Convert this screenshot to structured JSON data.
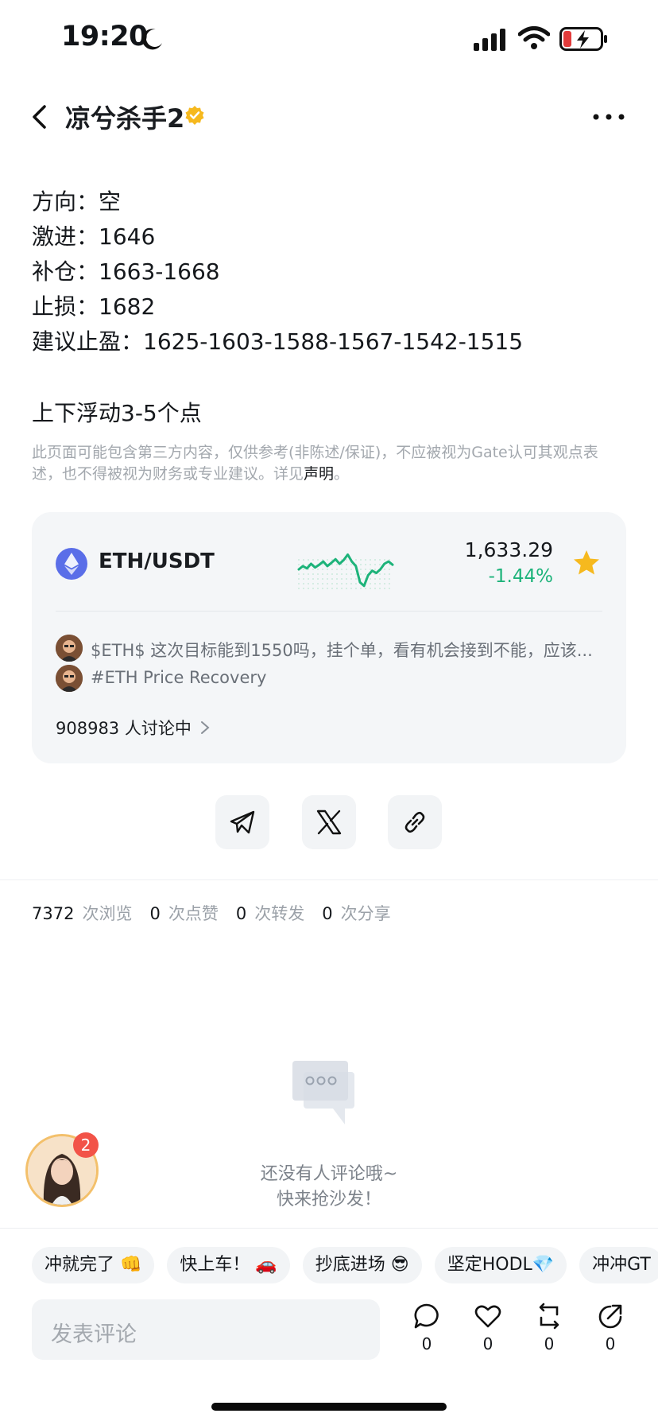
{
  "status_bar": {
    "time": "19:20"
  },
  "header": {
    "title": "凉兮杀手2"
  },
  "post": {
    "lines": [
      "方向：空",
      "激进：1646",
      "补仓：1663-1668",
      "止损：1682",
      "建议止盈：1625-1603-1588-1567-1542-1515"
    ],
    "note": "上下浮动3-5个点",
    "disclaimer": "此页面可能包含第三方内容，仅供参考(非陈述/保证)，不应被视为Gate认可其观点表述，也不得被视为财务或专业建议。详见",
    "disclaimer_link": "声明",
    "disclaimer_end": "。"
  },
  "ticker": {
    "pair": "ETH/USDT",
    "price": "1,633.29",
    "change": "-1.44%",
    "change_color": "#1db37a",
    "sparkline": [
      0.62,
      0.55,
      0.6,
      0.5,
      0.58,
      0.52,
      0.45,
      0.55,
      0.48,
      0.4,
      0.5,
      0.42,
      0.3,
      0.45,
      0.55,
      0.9,
      0.98,
      0.75,
      0.65,
      0.7,
      0.62,
      0.5,
      0.45,
      0.52
    ],
    "discussions": [
      {
        "text": "$ETH$  这次目标能到1550吗，挂个单，看有机会接到不能，应该..."
      },
      {
        "text": "#ETH Price Recovery"
      }
    ],
    "discuss_count": "908983 人讨论中"
  },
  "share": {
    "buttons": [
      "telegram-icon",
      "x-icon",
      "link-icon"
    ]
  },
  "stats": [
    {
      "num": "7372",
      "label": "次浏览"
    },
    {
      "num": "0",
      "label": "次点赞"
    },
    {
      "num": "0",
      "label": "次转发"
    },
    {
      "num": "0",
      "label": "次分享"
    }
  ],
  "empty": {
    "line1": "还没有人评论哦~",
    "line2": "快来抢沙发！"
  },
  "floating": {
    "badge": "2"
  },
  "chips": [
    "冲就完了 👊",
    "快上车！ 🚗",
    "抄底进场 😎",
    "坚定HODL💎",
    "冲冲GT"
  ],
  "comment": {
    "placeholder": "发表评论"
  },
  "actions": [
    {
      "icon": "comment-icon",
      "count": "0"
    },
    {
      "icon": "heart-icon",
      "count": "0"
    },
    {
      "icon": "repost-icon",
      "count": "0"
    },
    {
      "icon": "share-icon",
      "count": "0"
    }
  ],
  "colors": {
    "accent": "#1db37a",
    "star": "#f6b91e",
    "badge": "#f25348"
  }
}
